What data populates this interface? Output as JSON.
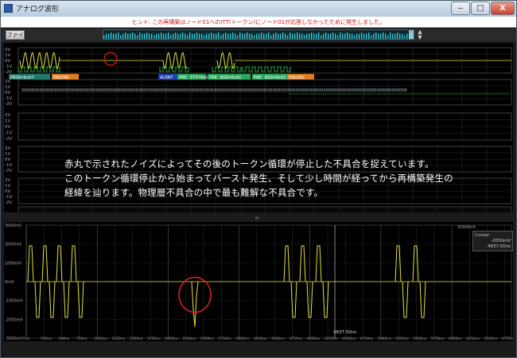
{
  "window": {
    "title": "アナログ波形",
    "minimize": "‒",
    "maximize": "□",
    "close": "X"
  },
  "hint": "ヒント: この再構築はノード01へのITT(トークン)にノード01が応答しなかったために発生しました。",
  "toolbar": {
    "file_label": "ファイル"
  },
  "digital": {
    "channel_labels": [
      "2V",
      "1V",
      "0V",
      "-1V",
      "-2V"
    ],
    "decode_labels": [
      {
        "text": "PNID=0x0f",
        "color": "#1f7a6a"
      },
      {
        "text": "ENDING",
        "color": "#e07a1f"
      },
      {
        "text": "ALERT",
        "color": "#1e3fb0"
      },
      {
        "text": "PRE",
        "color": "#2aa85a"
      },
      {
        "text": "ITT=0x0",
        "color": "#2aa85a"
      },
      {
        "text": "PRE",
        "color": "#2aa85a"
      },
      {
        "text": "NID=0x01",
        "color": "#2aa85a"
      },
      {
        "text": "PRE",
        "color": "#2aa85a"
      },
      {
        "text": "NID=0x01",
        "color": "#2aa85a"
      },
      {
        "text": "ENDING",
        "color": "#e07a1f"
      }
    ],
    "bits": "00000000000000000000000000000000000000000000000000000000000000000000000000000000000000000000000000000000000000000000000000000000000000000000000000000000"
  },
  "annotation": {
    "lines": [
      "赤丸で示されたノイズによってその後のトークン循環が停止した不具合を捉えています。",
      "このトークン循環停止から始まってバースト発生、そして少し時間が経ってから再構築発生の",
      "経緯を辿ります。物理層不具合の中で最も難解な不具合です。"
    ]
  },
  "analog": {
    "y_labels": [
      "3000mV",
      "2000mV",
      "1000mV",
      "0mV",
      "-1000mV",
      "-2000mV",
      "-3000mV"
    ],
    "x_labels": [
      "0ns",
      "250ns",
      "500ns",
      "750ns",
      "1000ns",
      "1250ns",
      "1500ns",
      "1750ns",
      "2000ns",
      "2250ns",
      "2500ns",
      "2750ns",
      "3000ns",
      "3250ns",
      "3500ns",
      "3750ns",
      "4000ns",
      "4250ns",
      "4500ns",
      "4750ns",
      "5000ns",
      "5250ns",
      "5500ns",
      "5750ns",
      "6000ns",
      "6250ns",
      "6500ns",
      "6750ns"
    ],
    "top_right_label": "3000mV",
    "marker_label": "4837.50ns",
    "cursor": {
      "title": "Cursor",
      "value_mv": "-2050mV",
      "value_ns": "4837.50ns"
    }
  },
  "colors": {
    "trace": "#e6e13a",
    "grid": "#3a3a3a",
    "highlight": "#e02020"
  }
}
